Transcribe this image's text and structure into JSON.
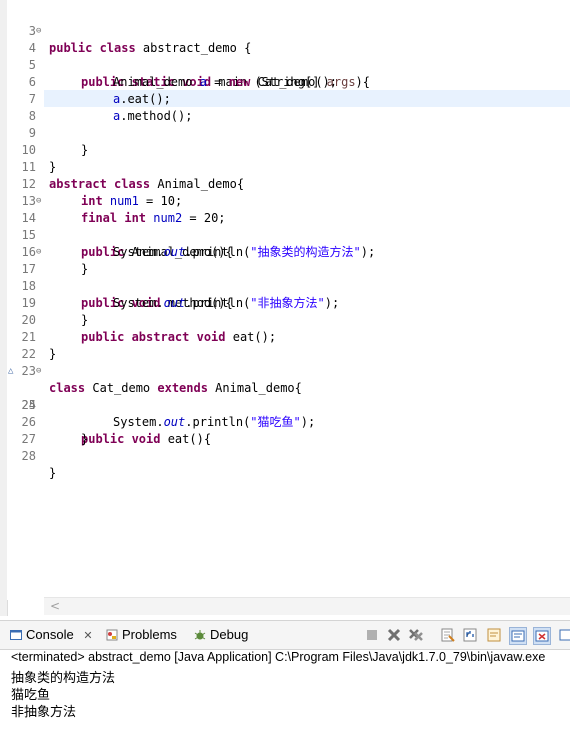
{
  "editor": {
    "lines": [
      {
        "n": "3",
        "fold": ""
      },
      {
        "n": "4",
        "fold": "⊖"
      },
      {
        "n": "5",
        "fold": ""
      },
      {
        "n": "6",
        "fold": ""
      },
      {
        "n": "7",
        "fold": ""
      },
      {
        "n": "8",
        "fold": ""
      },
      {
        "n": "9",
        "fold": ""
      },
      {
        "n": "10",
        "fold": ""
      },
      {
        "n": "11",
        "fold": ""
      },
      {
        "n": "12",
        "fold": ""
      },
      {
        "n": "13",
        "fold": ""
      },
      {
        "n": "14",
        "fold": "⊖"
      },
      {
        "n": "15",
        "fold": ""
      },
      {
        "n": "16",
        "fold": ""
      },
      {
        "n": "17",
        "fold": "⊖"
      },
      {
        "n": "18",
        "fold": ""
      },
      {
        "n": "19",
        "fold": ""
      },
      {
        "n": "20",
        "fold": ""
      },
      {
        "n": "21",
        "fold": ""
      },
      {
        "n": "22",
        "fold": ""
      },
      {
        "n": "23",
        "fold": ""
      },
      {
        "n": "24",
        "fold": "⊖"
      },
      {
        "n": "25",
        "fold": ""
      },
      {
        "n": "26",
        "fold": ""
      },
      {
        "n": "27",
        "fold": ""
      },
      {
        "n": "28",
        "fold": ""
      }
    ],
    "code": {
      "l3": {
        "k1": "public class",
        "t1": " abstract_demo {"
      },
      "l4": {
        "k1": "public static void",
        "t1": " main (String[] ",
        "p1": "args",
        "t2": "){"
      },
      "l5": {
        "t1": "Animal_demo ",
        "v1": "a",
        "t2": " = ",
        "k1": "new",
        "t3": " Cat_demo();"
      },
      "l6": {
        "v1": "a",
        "t1": ".eat();"
      },
      "l7": {
        "v1": "a",
        "t1": ".method();"
      },
      "l9": {
        "t1": "}"
      },
      "l10": {
        "t1": "}"
      },
      "l11": {
        "k1": "abstract class",
        "t1": " Animal_demo{"
      },
      "l12": {
        "k1": "int",
        "t1": " ",
        "v1": "num1",
        "t2": " = 10;"
      },
      "l13": {
        "k1": "final int",
        "t1": " ",
        "v1": "num2",
        "t2": " = 20;"
      },
      "l14": {
        "k1": "public",
        "t1": " Animal_demo(){"
      },
      "l15": {
        "t1": "System.",
        "f1": "out",
        "t2": ".println(",
        "s1": "\"抽象类的构造方法\"",
        "t3": ");"
      },
      "l16": {
        "t1": "}"
      },
      "l17": {
        "k1": "public void",
        "t1": " method(){"
      },
      "l18": {
        "t1": "System.",
        "f1": "out",
        "t2": ".println(",
        "s1": "\"非抽象方法\"",
        "t3": ");"
      },
      "l19": {
        "t1": "}"
      },
      "l20": {
        "k1": "public abstract void",
        "t1": " eat();"
      },
      "l21": {
        "t1": "}"
      },
      "l23": {
        "k1": "class",
        "t1": " Cat_demo ",
        "k2": "extends",
        "t2": " Animal_demo{"
      },
      "l24": {
        "k1": "public void",
        "t1": " eat(){"
      },
      "l25": {
        "t1": "System.",
        "f1": "out",
        "t2": ".println(",
        "s1": "\"猫吃鱼\"",
        "t3": ");"
      },
      "l26": {
        "t1": "}"
      },
      "l28": {
        "t1": "}"
      }
    },
    "scroll_left_glyph": "<"
  },
  "console": {
    "tabs": {
      "console": "Console",
      "console_close": "✕",
      "problems": "Problems",
      "debug": "Debug"
    },
    "terminated_line": "<terminated> abstract_demo [Java Application] C:\\Program Files\\Java\\jdk1.7.0_79\\bin\\javaw.exe",
    "output": [
      "抽象类的构造方法",
      "猫吃鱼",
      "非抽象方法"
    ]
  },
  "colors": {
    "keyword": "#7f0055",
    "string": "#2a00ff",
    "field": "#0000c0",
    "current_line": "#e8f2fe"
  }
}
